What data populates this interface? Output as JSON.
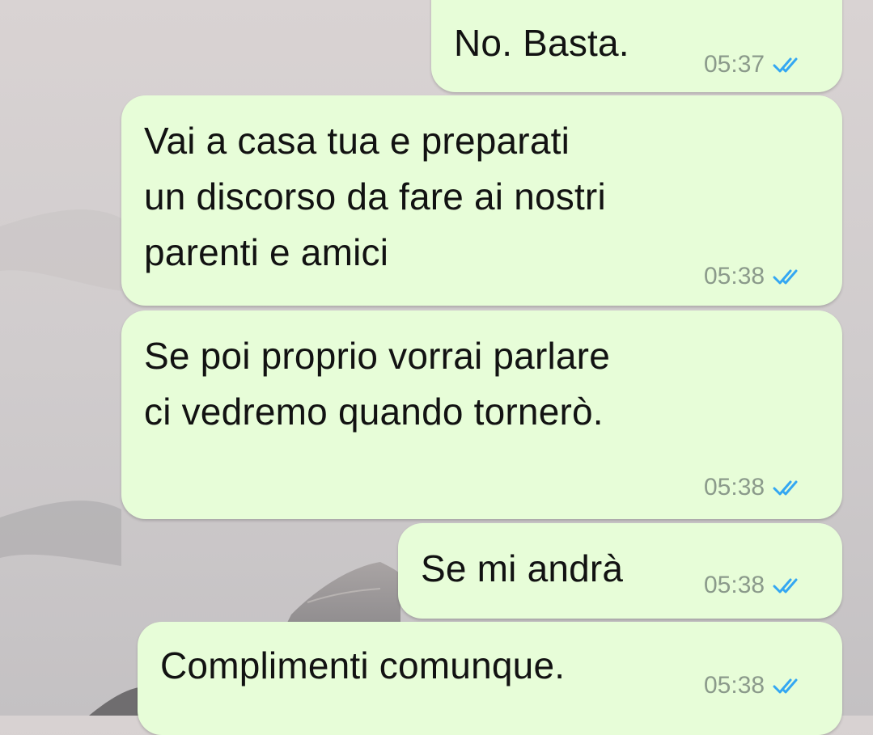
{
  "messages": [
    {
      "text": "No. Basta.",
      "time": "05:37",
      "status_icon": "double-check-read-icon"
    },
    {
      "text": "Vai a casa tua e preparati\nun discorso da fare ai nostri\nparenti e amici",
      "time": "05:38",
      "status_icon": "double-check-read-icon"
    },
    {
      "text": "Se poi proprio vorrai parlare\nci vedremo quando tornerò.",
      "time": "05:38",
      "status_icon": "double-check-read-icon"
    },
    {
      "text": "Se mi andrà",
      "time": "05:38",
      "status_icon": "double-check-read-icon"
    },
    {
      "text": "Complimenti comunque.",
      "time": "05:38",
      "status_icon": "double-check-read-icon"
    }
  ],
  "colors": {
    "bubble_out": "#e7fdd8",
    "timestamp": "#8b9a8b",
    "read_check": "#34a7f2"
  }
}
